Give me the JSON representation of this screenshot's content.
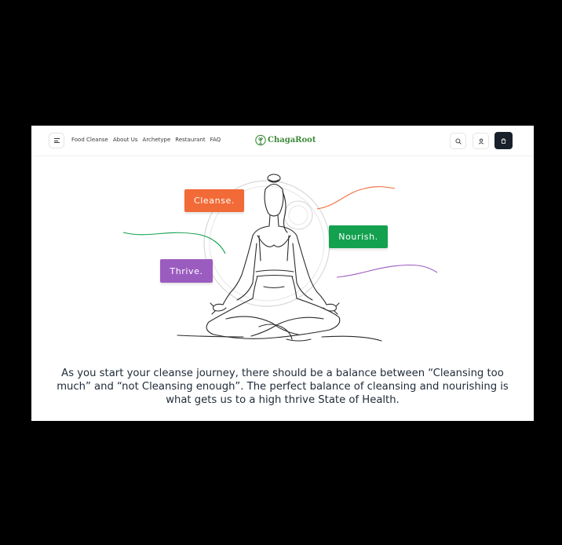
{
  "header": {
    "menu_icon": "hamburger-menu-icon",
    "nav": [
      "Food Cleanse",
      "About Us",
      "Archetype",
      "Restaurant",
      "FAQ"
    ],
    "brand": "ChagaRoot",
    "brand_color": "#3d8a3a",
    "actions": [
      "search-icon",
      "user-icon",
      "cart-icon"
    ]
  },
  "hero": {
    "tags": {
      "cleanse": {
        "label": "Cleanse.",
        "color": "#f26a37"
      },
      "nourish": {
        "label": "Nourish.",
        "color": "#13a14f"
      },
      "thrive": {
        "label": "Thrive.",
        "color": "#9b5cc0"
      }
    },
    "image": "meditating-woman-line-art"
  },
  "caption": "As you start your cleanse journey, there should be a balance between “Cleansing too much” and “not Cleansing enough”. The perfect balance of cleansing and nourishing is what gets us to a high thrive State of Health."
}
